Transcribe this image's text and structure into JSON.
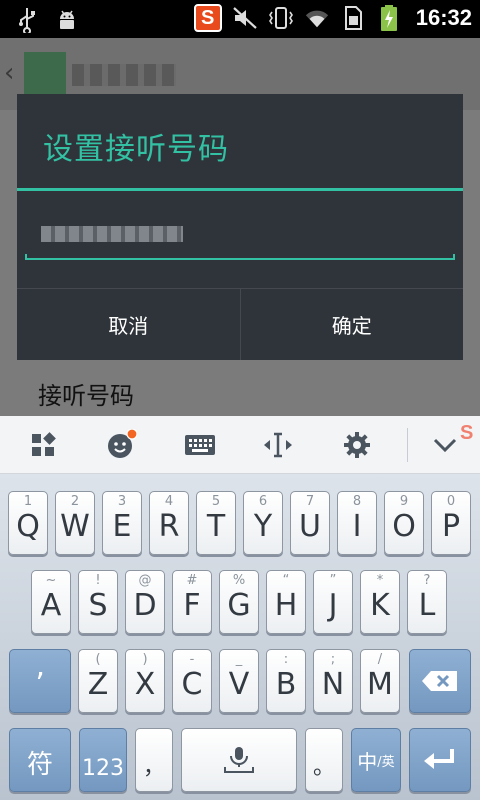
{
  "status_bar": {
    "time": "16:32",
    "icons": [
      "usb-icon",
      "android-debug-icon",
      "sogou-input-icon",
      "mute-icon",
      "vibrate-icon",
      "wifi-icon",
      "sim-icon",
      "battery-charging-icon"
    ],
    "sogou_letter": "S"
  },
  "background_app": {
    "row_label": "接听号码"
  },
  "dialog": {
    "title": "设置接听号码",
    "cancel_label": "取消",
    "confirm_label": "确定",
    "accent_color": "#33c1a4"
  },
  "keyboard_toolbar": {
    "icons": [
      "layout-grid-icon",
      "emoji-icon",
      "keyboard-icon",
      "cursor-move-icon",
      "settings-gear-icon",
      "collapse-chevron-icon"
    ],
    "notification_dot_color": "#f26522"
  },
  "keyboard": {
    "row1": [
      {
        "main": "Q",
        "sub": "1"
      },
      {
        "main": "W",
        "sub": "2"
      },
      {
        "main": "E",
        "sub": "3"
      },
      {
        "main": "R",
        "sub": "4"
      },
      {
        "main": "T",
        "sub": "5"
      },
      {
        "main": "Y",
        "sub": "6"
      },
      {
        "main": "U",
        "sub": "7"
      },
      {
        "main": "I",
        "sub": "8"
      },
      {
        "main": "O",
        "sub": "9"
      },
      {
        "main": "P",
        "sub": "0"
      }
    ],
    "row2": [
      {
        "main": "A",
        "sub": "~"
      },
      {
        "main": "S",
        "sub": "!"
      },
      {
        "main": "D",
        "sub": "@"
      },
      {
        "main": "F",
        "sub": "#"
      },
      {
        "main": "G",
        "sub": "%"
      },
      {
        "main": "H",
        "sub": "“"
      },
      {
        "main": "J",
        "sub": "”"
      },
      {
        "main": "K",
        "sub": "*"
      },
      {
        "main": "L",
        "sub": "?"
      }
    ],
    "row3": [
      {
        "main": "Z",
        "sub": "("
      },
      {
        "main": "X",
        "sub": ")"
      },
      {
        "main": "C",
        "sub": "-"
      },
      {
        "main": "V",
        "sub": "_"
      },
      {
        "main": "B",
        "sub": ":"
      },
      {
        "main": "N",
        "sub": ";"
      },
      {
        "main": "M",
        "sub": "/"
      }
    ],
    "apostrophe_key": "’",
    "symbol_key": "符",
    "number_key": "123",
    "comma_key": "，",
    "period_key": "。",
    "lang_key_main": "中",
    "lang_key_sub": "/英"
  }
}
